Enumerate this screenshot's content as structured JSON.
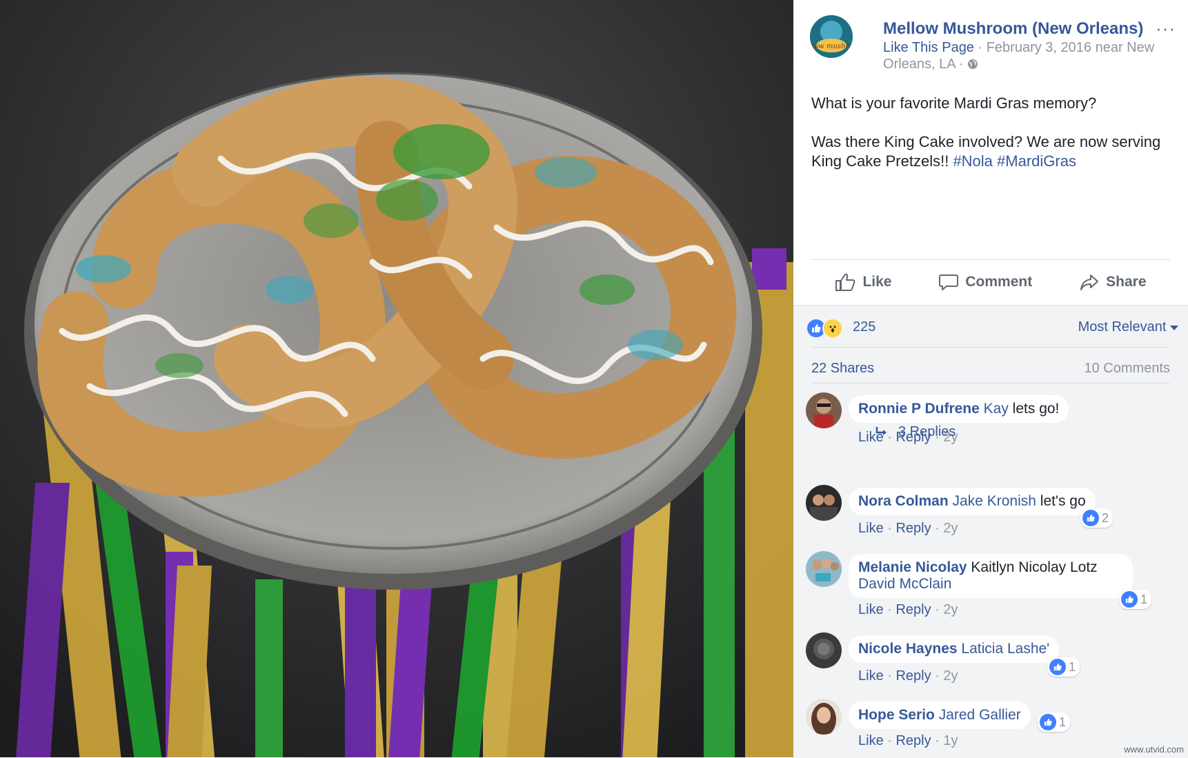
{
  "page": {
    "name": "Mellow Mushroom (New Orleans)",
    "like_page": "Like This Page",
    "meta_text": " · February 3, 2016 near New Orleans, LA · ",
    "more": "···",
    "avatar_text": "mellow mushroom"
  },
  "post": {
    "line1": "What is your favorite Mardi Gras memory?",
    "line2": "Was there King Cake involved? We are now serving King Cake Pretzels!! ",
    "tag1": "#Nola",
    "tag2": "#MardiGras"
  },
  "actions": {
    "like": "Like",
    "comment": "Comment",
    "share": "Share"
  },
  "stats": {
    "reaction_count": "225",
    "sort_label": "Most Relevant",
    "shares": "22 Shares",
    "comments": "10 Comments"
  },
  "comments": [
    {
      "author": "Ronnie P Dufrene",
      "mention": "Kay",
      "text": " lets go!",
      "like": "Like",
      "reply": "Reply",
      "time": "2y"
    },
    {
      "author": "Nora Colman",
      "mention": "Jake Kronish",
      "text": " let's go",
      "like": "Like",
      "reply": "Reply",
      "time": "2y",
      "reactions": "2"
    },
    {
      "author": "Melanie Nicolay",
      "mention": "Kaitlyn Nicolay Lotz",
      "mention2": "David McClain",
      "like": "Like",
      "reply": "Reply",
      "time": "2y",
      "reactions": "1"
    },
    {
      "author": "Nicole Haynes",
      "mention": "Laticia Lashe'",
      "like": "Like",
      "reply": "Reply",
      "time": "2y",
      "reactions": "1"
    },
    {
      "author": "Hope Serio",
      "mention": "Jared Gallier",
      "like": "Like",
      "reply": "Reply",
      "time": "1y",
      "reactions": "1"
    }
  ],
  "replies_link": "3 Replies",
  "watermark": "www.utvid.com",
  "colors": {
    "link": "#365899",
    "like_blue": "#4080ff",
    "muted": "#90949c"
  }
}
